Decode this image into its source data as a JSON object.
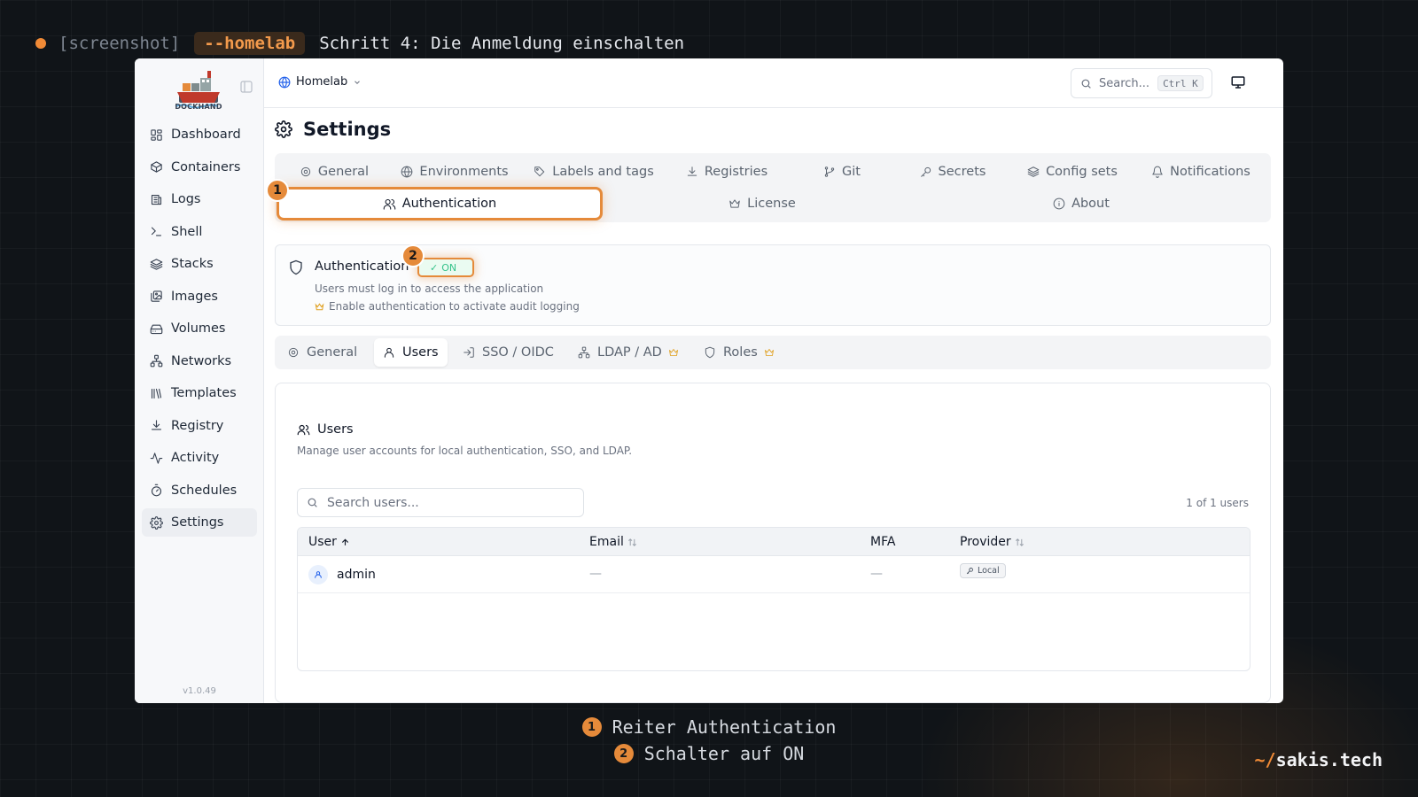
{
  "caption": {
    "tag": "[screenshot]",
    "pill": "--homelab",
    "title": "Schritt 4: Die Anmeldung einschalten"
  },
  "sidebar": {
    "logo_text": "DOCKHAND",
    "items": [
      {
        "label": "Dashboard",
        "icon": "dashboard-icon"
      },
      {
        "label": "Containers",
        "icon": "box-icon"
      },
      {
        "label": "Logs",
        "icon": "logs-icon"
      },
      {
        "label": "Shell",
        "icon": "terminal-icon"
      },
      {
        "label": "Stacks",
        "icon": "layers-icon"
      },
      {
        "label": "Images",
        "icon": "images-icon"
      },
      {
        "label": "Volumes",
        "icon": "hard-drive-icon"
      },
      {
        "label": "Networks",
        "icon": "network-icon"
      },
      {
        "label": "Templates",
        "icon": "library-icon"
      },
      {
        "label": "Registry",
        "icon": "download-icon"
      },
      {
        "label": "Activity",
        "icon": "activity-icon"
      },
      {
        "label": "Schedules",
        "icon": "timer-icon"
      },
      {
        "label": "Settings",
        "icon": "gear-icon",
        "active": true
      }
    ],
    "version": "v1.0.49"
  },
  "topbar": {
    "environment": "Homelab",
    "search_label": "Search...",
    "search_kbd": "Ctrl K"
  },
  "page": {
    "title": "Settings",
    "tabs": [
      {
        "label": "General",
        "icon": "gear-icon"
      },
      {
        "label": "Environments",
        "icon": "globe-icon"
      },
      {
        "label": "Labels and tags",
        "icon": "tag-icon"
      },
      {
        "label": "Registries",
        "icon": "download-icon"
      },
      {
        "label": "Git",
        "icon": "git-branch-icon"
      },
      {
        "label": "Secrets",
        "icon": "key-icon"
      },
      {
        "label": "Config sets",
        "icon": "layers-icon"
      },
      {
        "label": "Notifications",
        "icon": "bell-icon"
      },
      {
        "label": "Authentication",
        "icon": "users-icon",
        "active": true
      },
      {
        "label": "License",
        "icon": "crown-icon"
      },
      {
        "label": "About",
        "icon": "info-icon"
      }
    ]
  },
  "callouts": {
    "one": "1",
    "two": "2"
  },
  "auth": {
    "title": "Authentication",
    "toggle_state": "ON",
    "description": "Users must log in to access the application",
    "note": "Enable authentication to activate audit logging",
    "accent_color": "#e58a3a"
  },
  "subtabs": [
    {
      "label": "General",
      "icon": "gear-icon"
    },
    {
      "label": "Users",
      "icon": "user-icon",
      "active": true
    },
    {
      "label": "SSO / OIDC",
      "icon": "login-icon"
    },
    {
      "label": "LDAP / AD",
      "icon": "network-icon",
      "premium": true
    },
    {
      "label": "Roles",
      "icon": "shield-icon",
      "premium": true
    }
  ],
  "users": {
    "title": "Users",
    "description": "Manage user accounts for local authentication, SSO, and LDAP.",
    "search_placeholder": "Search users...",
    "count": "1 of 1 users",
    "columns": [
      "User",
      "Email",
      "MFA",
      "Provider"
    ],
    "rows": [
      {
        "user": "admin",
        "email": "—",
        "mfa": "—",
        "provider": "Local"
      }
    ]
  },
  "legend": [
    {
      "num": "1",
      "text": "Reiter Authentication"
    },
    {
      "num": "2",
      "text": "Schalter auf ON"
    }
  ],
  "brand": {
    "prefix": "~/",
    "name": "sakis.tech"
  }
}
